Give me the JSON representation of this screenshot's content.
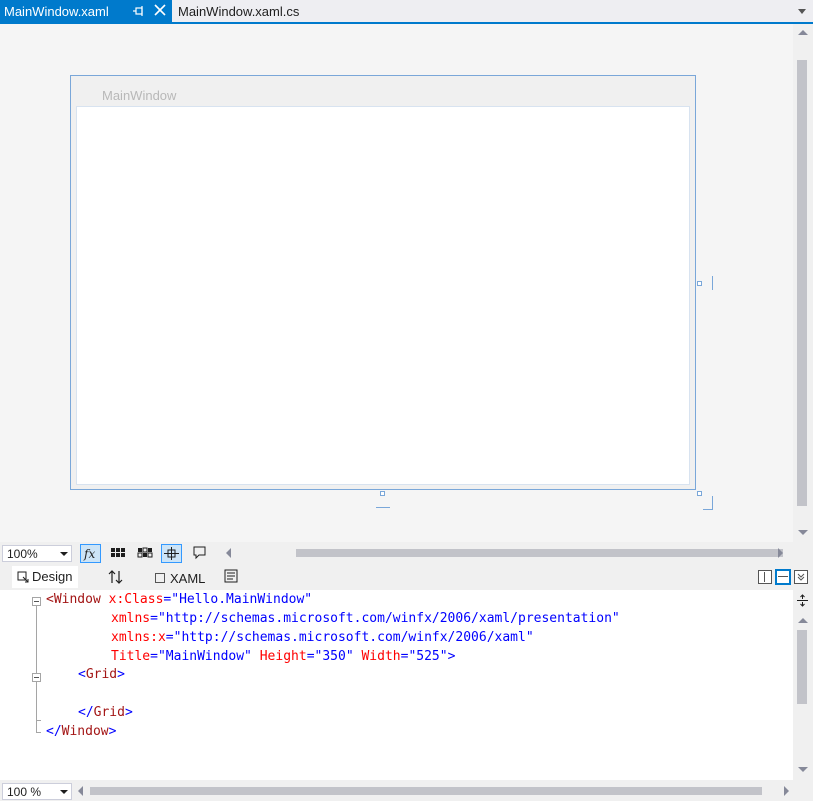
{
  "tabs": {
    "active_label": "MainWindow.xaml",
    "inactive_label": "MainWindow.xaml.cs"
  },
  "designer": {
    "window_title": "MainWindow"
  },
  "designer_toolbar": {
    "zoom": "100%",
    "buttons": [
      "fx-icon",
      "grid-icon",
      "snap-grid-icon",
      "snap-lines-icon",
      "annotation-icon"
    ]
  },
  "split": {
    "design_label": "Design",
    "xaml_label": "XAML"
  },
  "code": {
    "l1_br_open": "<",
    "l1_tag": "Window",
    "l1_attr": "x:Class",
    "l1_val": "\"Hello.MainWindow\"",
    "l2_attr": "xmlns",
    "l2_val": "\"http://schemas.microsoft.com/winfx/2006/xaml/presentation\"",
    "l3_attr": "xmlns:x",
    "l3_val": "\"http://schemas.microsoft.com/winfx/2006/xaml\"",
    "l4_attr1": "Title",
    "l4_val1": "\"MainWindow\"",
    "l4_attr2": "Height",
    "l4_val2": "\"350\"",
    "l4_attr3": "Width",
    "l4_val3": "\"525\"",
    "l4_close": ">",
    "l5_open": "<",
    "l5_tag": "Grid",
    "l5_close": ">",
    "l7_open": "</",
    "l7_tag": "Grid",
    "l7_close": ">",
    "l8_open": "</",
    "l8_tag": "Window",
    "l8_close": ">"
  },
  "bottom": {
    "zoom": "100 %"
  },
  "colors": {
    "accent": "#007acc",
    "tag": "#a31515",
    "attribute": "#ff0000",
    "value": "#0000ff"
  }
}
